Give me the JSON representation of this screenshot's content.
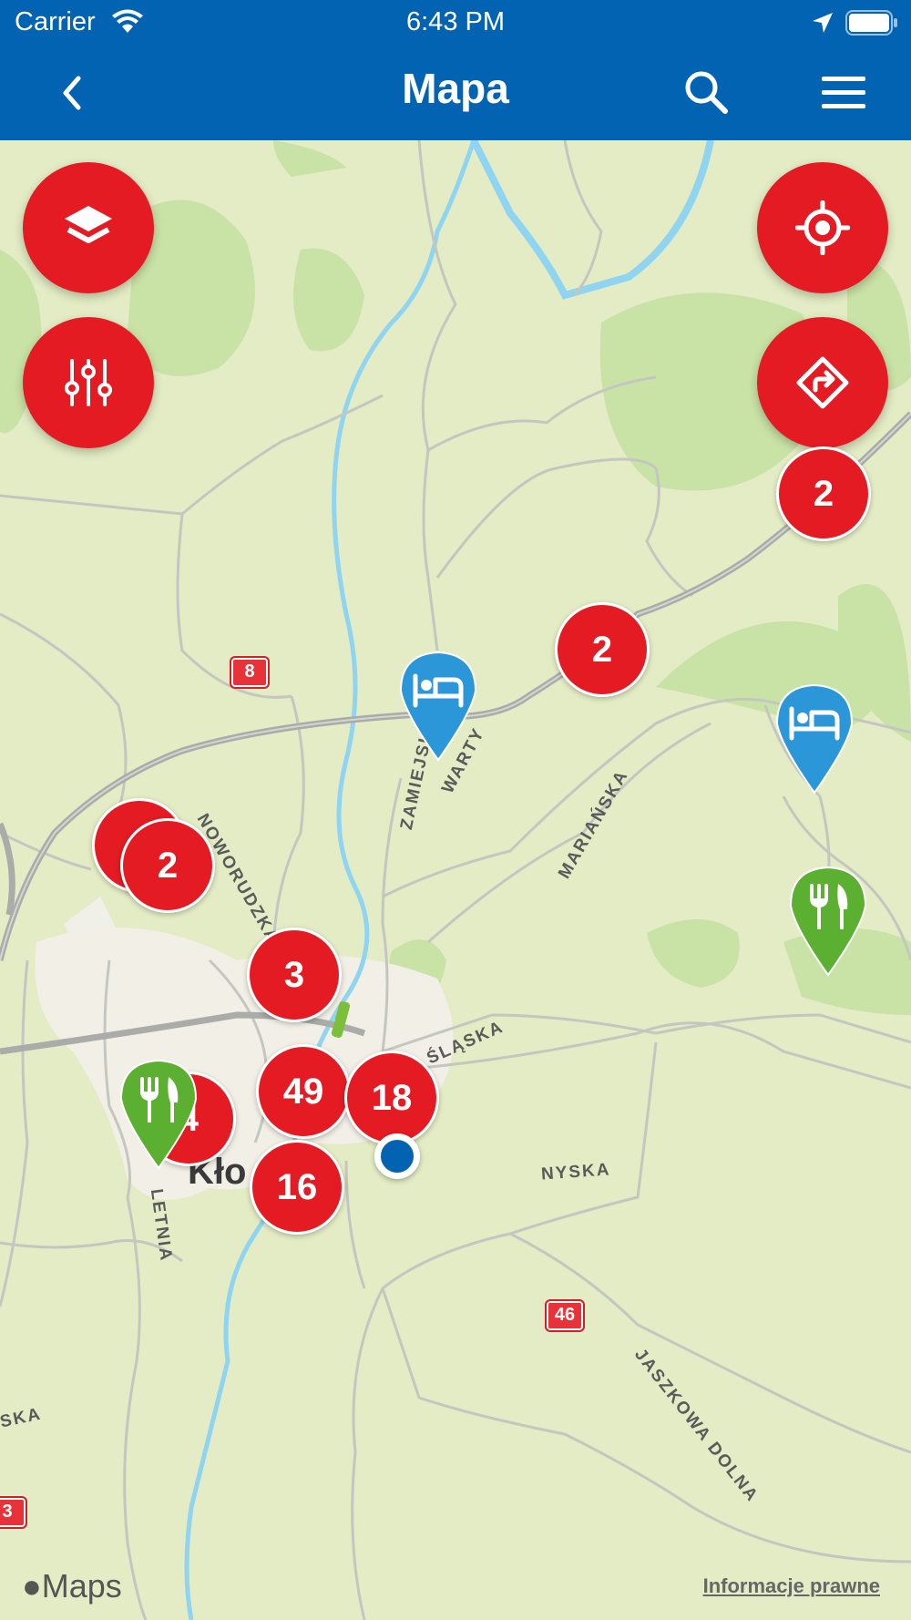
{
  "status_bar": {
    "carrier": "Carrier",
    "time": "6:43 PM",
    "wifi_icon": "wifi-icon",
    "location_icon": "location-arrow-icon",
    "battery_icon": "battery-icon"
  },
  "header": {
    "title": "Mapa",
    "back_icon": "chevron-left-icon",
    "search_icon": "search-icon",
    "menu_icon": "hamburger-menu-icon",
    "background_color": "#0163b1"
  },
  "map_controls": {
    "layers_icon": "layers-icon",
    "filters_icon": "sliders-icon",
    "locate_icon": "crosshair-icon",
    "directions_icon": "directions-icon",
    "accent_color": "#e41b23"
  },
  "clusters": {
    "c1": "2",
    "c2": "2",
    "c3": "2",
    "c4": "3",
    "c5": "49",
    "c6": "18",
    "c7": "16",
    "c8": "4"
  },
  "pins": {
    "hotel_icon": "bed-icon",
    "restaurant_icon": "fork-knife-icon",
    "hotel_color": "#2b96d8",
    "restaurant_color": "#5bb031"
  },
  "map_labels": {
    "city": "Kło",
    "roads": {
      "zamiejska": "ZAMIEJSKA",
      "warty": "WARTY",
      "marianska": "MARIAŃSKA",
      "noworudzka": "NOWORUDZKA",
      "slaska": "ŚLĄSKA",
      "nyska": "NYSKA",
      "letnia": "LETNIA",
      "jaszkowa": "JASZKOWA DOLNA",
      "ska": "SKA"
    },
    "shields": {
      "r8": "8",
      "r46": "46",
      "r3": "3"
    }
  },
  "footer": {
    "maps_logo": "Maps",
    "legal_link": "Informacje prawne"
  }
}
